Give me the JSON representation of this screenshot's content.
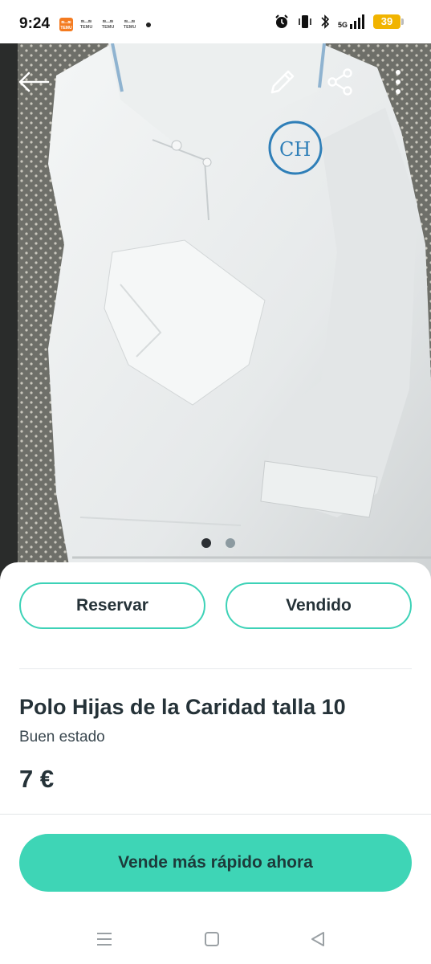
{
  "status_bar": {
    "time": "9:24",
    "network": "5G",
    "battery": "39",
    "notifications": [
      {
        "icon": "temu-app-icon",
        "label": "TEMU",
        "sub": "ஐ‿ஐ"
      },
      {
        "icon": "temu-notification-icon",
        "label": "TEMU",
        "sub": "ஐ‿ஐ"
      },
      {
        "icon": "temu-notification-icon",
        "label": "TEMU",
        "sub": "ஐ‿ஐ"
      },
      {
        "icon": "temu-notification-icon",
        "label": "TEMU",
        "sub": "ஐ‿ஐ"
      }
    ]
  },
  "hero": {
    "image_description_icon": "product-photo",
    "pager": {
      "total": 2,
      "current": 1
    }
  },
  "actions": {
    "reserve_label": "Reservar",
    "sold_label": "Vendido"
  },
  "product": {
    "title": "Polo Hijas de la Caridad talla 10",
    "condition": "Buen estado",
    "price": "7 €"
  },
  "cta": {
    "label": "Vende más rápido ahora"
  },
  "colors": {
    "accent": "#3ed5b6",
    "text": "#253238"
  }
}
